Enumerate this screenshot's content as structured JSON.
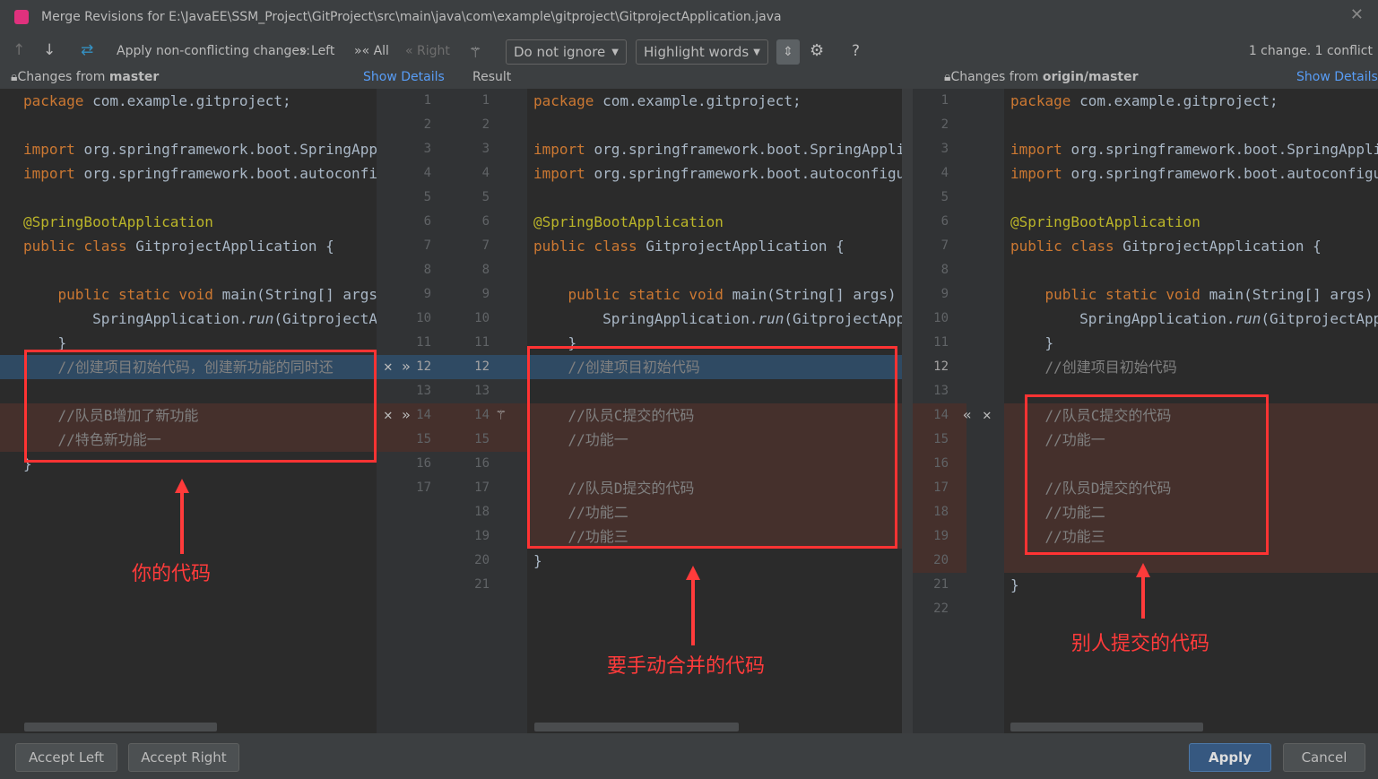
{
  "window": {
    "title": "Merge Revisions for E:\\JavaEE\\SSM_Project\\GitProject\\src\\main\\java\\com\\example\\gitproject\\GitprojectApplication.java"
  },
  "toolbar": {
    "apply_label": "Apply non-conflicting changes:",
    "left": "Left",
    "all": "All",
    "right": "Right",
    "ignore": "Do not ignore",
    "highlight": "Highlight words",
    "help": "?",
    "status": "1 change. 1 conflict"
  },
  "headers": {
    "left_prefix": "Changes from ",
    "left_branch": "master",
    "show_details": "Show Details",
    "result": "Result",
    "right_prefix": "Changes from ",
    "right_branch": "origin/master"
  },
  "panes": {
    "left": [
      [
        [
          "kw",
          "package "
        ],
        [
          "tx",
          "com.example.gitproject;"
        ]
      ],
      [],
      [
        [
          "kw",
          "import "
        ],
        [
          "tx",
          "org.springframework.boot.SpringApplication;"
        ]
      ],
      [
        [
          "kw",
          "import "
        ],
        [
          "tx",
          "org.springframework.boot.autoconfigure.SpringBootApplication;"
        ]
      ],
      [],
      [
        [
          "an",
          "@SpringBootApplication"
        ]
      ],
      [
        [
          "kw",
          "public class "
        ],
        [
          "tx",
          "GitprojectApplication {"
        ]
      ],
      [],
      [
        [
          "kw",
          "    public static void "
        ],
        [
          "tx",
          "main(String[] args) {"
        ]
      ],
      [
        [
          "tx",
          "        SpringApplication."
        ],
        [
          "it",
          "run"
        ],
        [
          "tx",
          "(GitprojectApplication.class, args);"
        ]
      ],
      [
        [
          "tx",
          "    }"
        ]
      ],
      [
        [
          "cm",
          "    //创建项目初始代码，创建新功能的同时还"
        ]
      ],
      [],
      [
        [
          "cm",
          "    //队员B增加了新功能"
        ]
      ],
      [
        [
          "cm",
          "    //特色新功能一"
        ]
      ],
      [
        [
          "tx",
          "}"
        ]
      ],
      []
    ],
    "center": [
      [
        [
          "kw",
          "package "
        ],
        [
          "tx",
          "com.example.gitproject;"
        ]
      ],
      [],
      [
        [
          "kw",
          "import "
        ],
        [
          "tx",
          "org.springframework.boot.SpringApplication;"
        ]
      ],
      [
        [
          "kw",
          "import "
        ],
        [
          "tx",
          "org.springframework.boot.autoconfigure.SpringBootApplication;"
        ]
      ],
      [],
      [
        [
          "an",
          "@SpringBootApplication"
        ]
      ],
      [
        [
          "kw",
          "public class "
        ],
        [
          "tx",
          "GitprojectApplication {"
        ]
      ],
      [],
      [
        [
          "kw",
          "    public static void "
        ],
        [
          "tx",
          "main(String[] args) {"
        ]
      ],
      [
        [
          "tx",
          "        SpringApplication."
        ],
        [
          "it",
          "run"
        ],
        [
          "tx",
          "(GitprojectApplication.class, args);"
        ]
      ],
      [
        [
          "tx",
          "    }"
        ]
      ],
      [
        [
          "cm",
          "    //创建项目初始代码"
        ]
      ],
      [],
      [
        [
          "cm",
          "    //队员C提交的代码"
        ]
      ],
      [
        [
          "cm",
          "    //功能一"
        ]
      ],
      [],
      [
        [
          "cm",
          "    //队员D提交的代码"
        ]
      ],
      [
        [
          "cm",
          "    //功能二"
        ]
      ],
      [
        [
          "cm",
          "    //功能三"
        ]
      ],
      [
        [
          "tx",
          "}"
        ]
      ],
      []
    ],
    "right": [
      [
        [
          "kw",
          "package "
        ],
        [
          "tx",
          "com.example.gitproject;"
        ]
      ],
      [],
      [
        [
          "kw",
          "import "
        ],
        [
          "tx",
          "org.springframework.boot.SpringApplication;"
        ]
      ],
      [
        [
          "kw",
          "import "
        ],
        [
          "tx",
          "org.springframework.boot.autoconfigure.SpringBootApplication;"
        ]
      ],
      [],
      [
        [
          "an",
          "@SpringBootApplication"
        ]
      ],
      [
        [
          "kw",
          "public class "
        ],
        [
          "tx",
          "GitprojectApplication {"
        ]
      ],
      [],
      [
        [
          "kw",
          "    public static void "
        ],
        [
          "tx",
          "main(String[] args) {"
        ]
      ],
      [
        [
          "tx",
          "        SpringApplication."
        ],
        [
          "it",
          "run"
        ],
        [
          "tx",
          "(GitprojectApplication.class, args);"
        ]
      ],
      [
        [
          "tx",
          "    }"
        ]
      ],
      [
        [
          "cm",
          "    //创建项目初始代码"
        ]
      ],
      [],
      [
        [
          "cm",
          "    //队员C提交的代码"
        ]
      ],
      [
        [
          "cm",
          "    //功能一"
        ]
      ],
      [],
      [
        [
          "cm",
          "    //队员D提交的代码"
        ]
      ],
      [
        [
          "cm",
          "    //功能二"
        ]
      ],
      [
        [
          "cm",
          "    //功能三"
        ]
      ],
      [],
      [
        [
          "tx",
          "}"
        ]
      ],
      []
    ]
  },
  "annotations": {
    "yours": "你的代码",
    "merge": "要手动合并的代码",
    "others": "别人提交的代码"
  },
  "footer": {
    "accept_left": "Accept Left",
    "accept_right": "Accept Right",
    "apply": "Apply",
    "cancel": "Cancel"
  },
  "colors": {
    "accent": "#365880",
    "conflict": "#45302c",
    "annotation_red": "#ff3333"
  }
}
